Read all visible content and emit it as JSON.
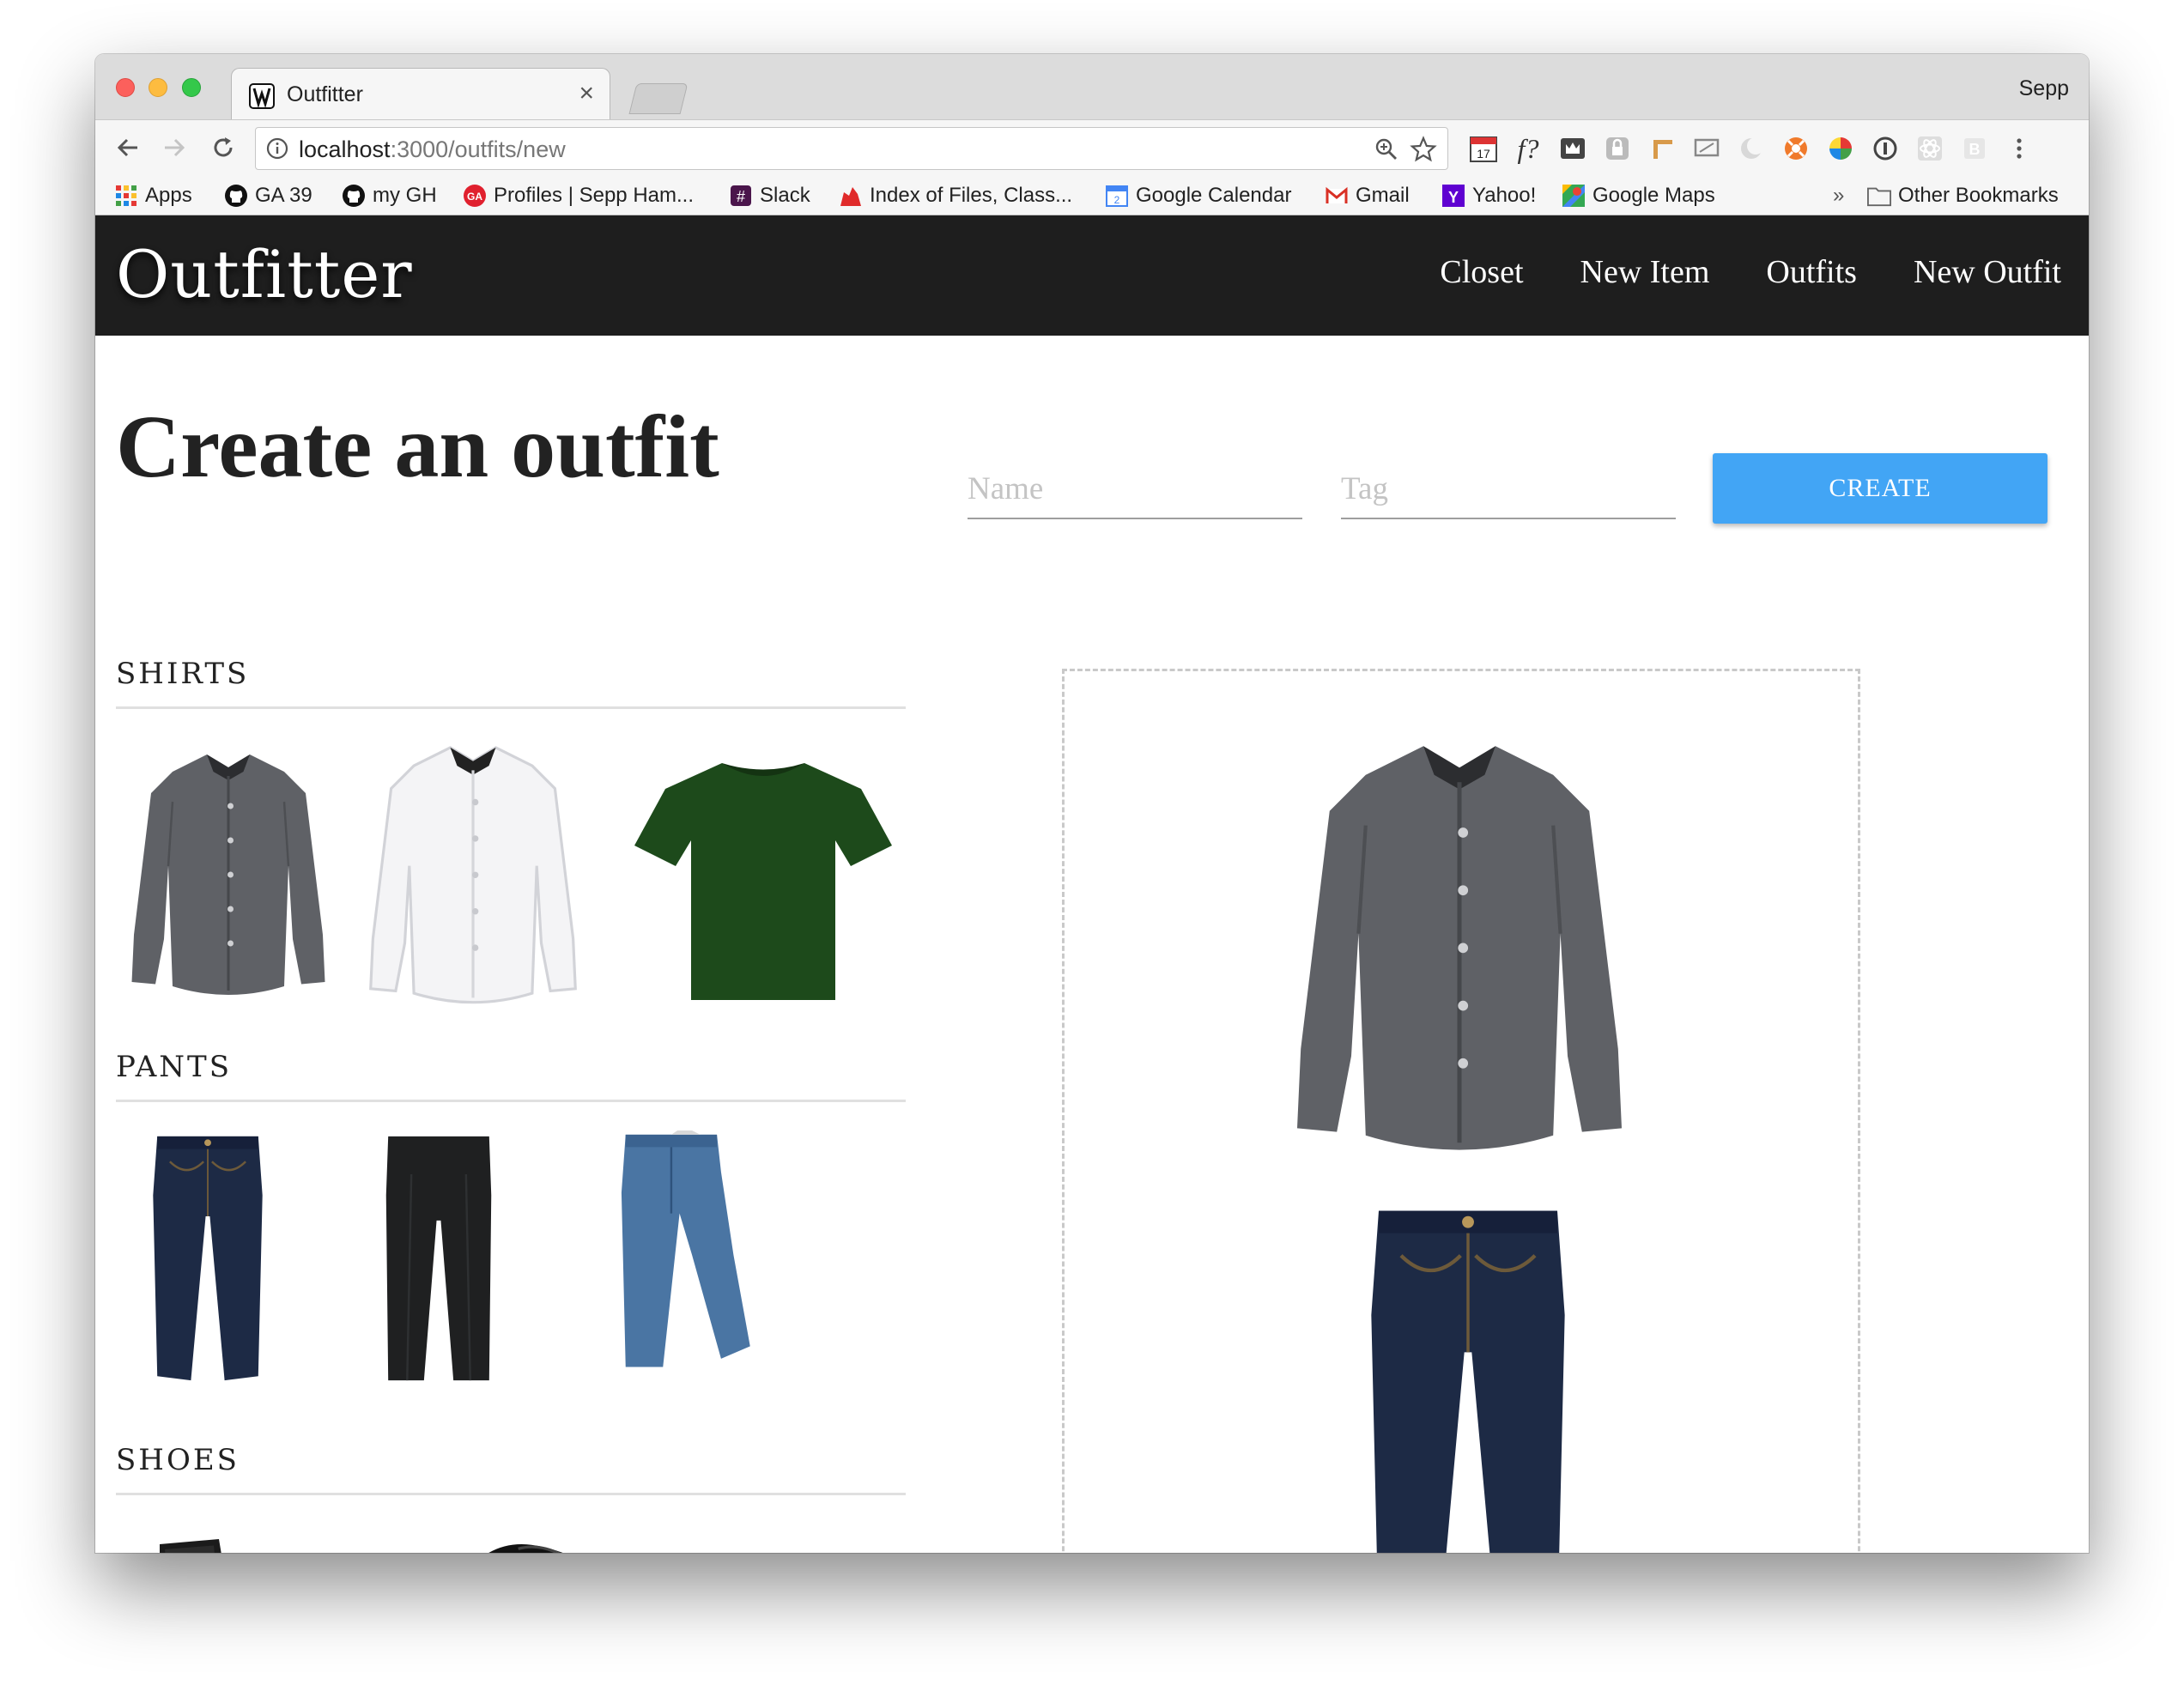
{
  "browser": {
    "tab_title": "Outfitter",
    "profile_name": "Sepp",
    "url_host": "localhost",
    "url_path": ":3000/outfits/new",
    "bookmarks": [
      {
        "label": "Apps",
        "icon": "apps-grid-icon"
      },
      {
        "label": "GA 39",
        "icon": "github-icon"
      },
      {
        "label": "my GH",
        "icon": "github-icon"
      },
      {
        "label": "Profiles | Sepp Ham...",
        "icon": "ga-icon"
      },
      {
        "label": "Slack",
        "icon": "slack-icon"
      },
      {
        "label": "Index of Files, Class...",
        "icon": "files-icon"
      },
      {
        "label": "Google Calendar",
        "icon": "calendar-icon"
      },
      {
        "label": "Gmail",
        "icon": "gmail-icon"
      },
      {
        "label": "Yahoo!",
        "icon": "yahoo-icon"
      },
      {
        "label": "Google Maps",
        "icon": "maps-icon"
      }
    ],
    "overflow_label": "»",
    "other_bookmarks": "Other Bookmarks",
    "calendar_ext_day": "17",
    "font_ext_label": "f?"
  },
  "site": {
    "brand": "Outfitter",
    "nav": [
      "Closet",
      "New Item",
      "Outfits",
      "New Outfit"
    ],
    "page_title": "Create an outfit",
    "name_placeholder": "Name",
    "tag_placeholder": "Tag",
    "create_label": "CREATE",
    "sections": {
      "shirts": "SHIRTS",
      "pants": "PANTS",
      "shoes": "SHOES"
    }
  },
  "colors": {
    "accent": "#42a5f5",
    "navbar": "#1e1e1e",
    "shirt_gray": "#5f6166",
    "tshirt_green": "#1d4a1b",
    "denim_dark": "#1d2a45",
    "denim_light": "#4a75a3"
  }
}
